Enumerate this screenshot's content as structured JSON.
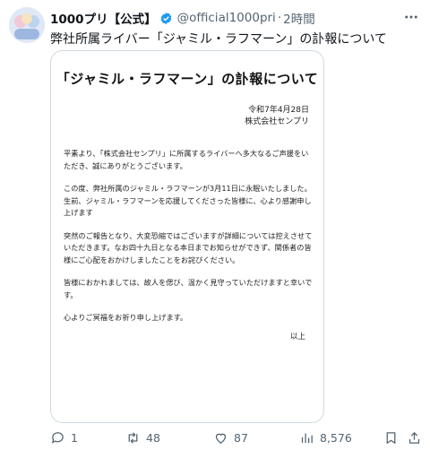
{
  "post": {
    "author_name": "1000プリ【公式】",
    "handle": "@official1000pri",
    "separator": "·",
    "time": "2時間",
    "text": "弊社所属ライバー「ジャミル・ラフマーン」の訃報について"
  },
  "document": {
    "title": "「ジャミル・ラフマーン」の訃報について",
    "date": "令和7年4月28日",
    "company": "株式会社センプリ",
    "paragraphs": [
      "平素より、「株式会社センプリ」に所属するライバーへ多大なるご声援をいただき、誠にありがとうございます。",
      "この度、弊社所属のジャミル・ラフマーンが3月11日に永眠いたしました。生前、ジャミル・ラフマーンを応援してくださった皆様に、心より感謝申し上げます",
      "突然のご報告となり、大変恐縮ではございますが詳細については控えさせていただきます。なお四十九日となる本日までお知らせができず、関係者の皆様にご心配をおかけしましたことをお詫びください。",
      "皆様におかれましては、故人を偲び、温かく見守っていただけますと幸いです。",
      "心よりご冥福をお祈り申し上げます。"
    ],
    "closing": "以上"
  },
  "actions": {
    "replies": "1",
    "reposts": "48",
    "likes": "87",
    "views": "8,576"
  },
  "icons": [
    "verified-badge-icon",
    "more-icon",
    "reply-icon",
    "repost-icon",
    "like-icon",
    "views-icon",
    "bookmark-icon",
    "share-icon"
  ],
  "colors": {
    "verified": "#1d9bf0",
    "text_secondary": "#536471",
    "border": "#cfd9de"
  }
}
